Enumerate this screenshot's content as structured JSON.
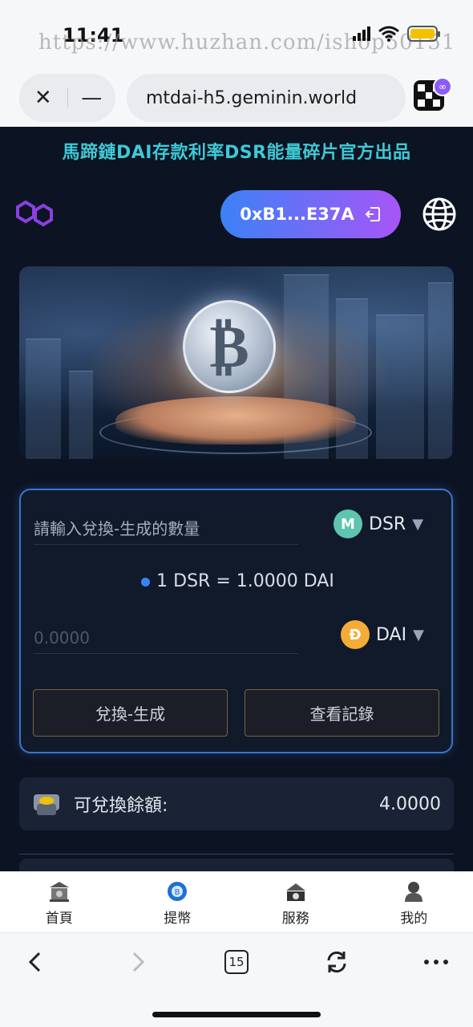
{
  "status_bar": {
    "time": "11:41",
    "watermark": "https://www.huzhan.com/ishop50151"
  },
  "browser": {
    "url": "mtdai-h5.geminin.world",
    "close_icon": "close-icon",
    "minimize_icon": "minus-icon",
    "wallet_app_icon": "okx-wallet-icon"
  },
  "dapp": {
    "title": "馬蹄鏈DAI存款利率DSR能量碎片官方出品",
    "wallet_address": "0xB1...E37A",
    "brand_icon": "polygon-logo-icon",
    "language_icon": "globe-icon"
  },
  "swap": {
    "input_placeholder": "請輸入兌換-生成的數量",
    "from_token": "DSR",
    "rate_text": "1 DSR = 1.0000 DAI",
    "output_value": "0.0000",
    "to_token": "DAI",
    "exchange_button": "兌換-生成",
    "history_button": "查看記錄"
  },
  "balance": {
    "label": "可兌換餘額:",
    "value": "4.0000"
  },
  "tabbar": {
    "items": [
      {
        "label": "首頁",
        "icon": "home-bank-icon"
      },
      {
        "label": "提幣",
        "icon": "coin-withdraw-icon"
      },
      {
        "label": "服務",
        "icon": "service-icon"
      },
      {
        "label": "我的",
        "icon": "profile-icon"
      }
    ]
  },
  "browser_bottom": {
    "tab_count": "15",
    "icons": [
      "back-icon",
      "forward-icon",
      "tabs-icon",
      "refresh-icon",
      "more-icon"
    ]
  },
  "colors": {
    "dapp_background": "#0c1322",
    "title_cyan": "#3ec9d6",
    "wallet_gradient_start": "#3b82f6",
    "wallet_gradient_end": "#a855f7",
    "card_border": "#3a74c9",
    "dsr_token": "#5fc4b0",
    "dai_token": "#f5ac37",
    "button_border": "#7a6440"
  }
}
